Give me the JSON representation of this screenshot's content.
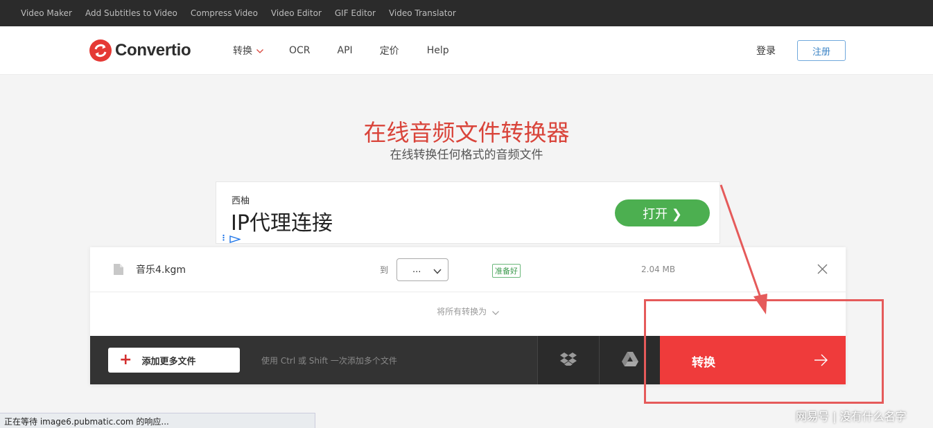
{
  "topbar": {
    "links": [
      "Video Maker",
      "Add Subtitles to Video",
      "Compress Video",
      "Video Editor",
      "GIF Editor",
      "Video Translator"
    ]
  },
  "header": {
    "logo_text": "Convertio",
    "nav": [
      {
        "label": "转换",
        "has_dropdown": true
      },
      {
        "label": "OCR"
      },
      {
        "label": "API"
      },
      {
        "label": "定价"
      },
      {
        "label": "Help"
      }
    ],
    "login_label": "登录",
    "signup_label": "注册"
  },
  "hero": {
    "title": "在线音频文件转换器",
    "subtitle": "在线转换任何格式的音频文件"
  },
  "ad": {
    "brand": "西柚",
    "headline": "IP代理连接",
    "button_label": "打开 ❯"
  },
  "file": {
    "name": "音乐4.kgm",
    "to_label": "到",
    "format_value": "...",
    "status": "准备好",
    "size": "2.04 MB"
  },
  "convert_all_label": "将所有转换为",
  "actions": {
    "add_files_label": "添加更多文件",
    "hint": "使用 Ctrl 或 Shift 一次添加多个文件",
    "convert_label": "转换"
  },
  "status_bar": "正在等待 image6.pubmatic.com 的响应...",
  "watermark": "网易号 | 没有什么名字",
  "colors": {
    "accent": "#ef3b3b",
    "title": "#d9443a",
    "ad_button": "#4caf50",
    "annotation": "#e55a5a"
  }
}
